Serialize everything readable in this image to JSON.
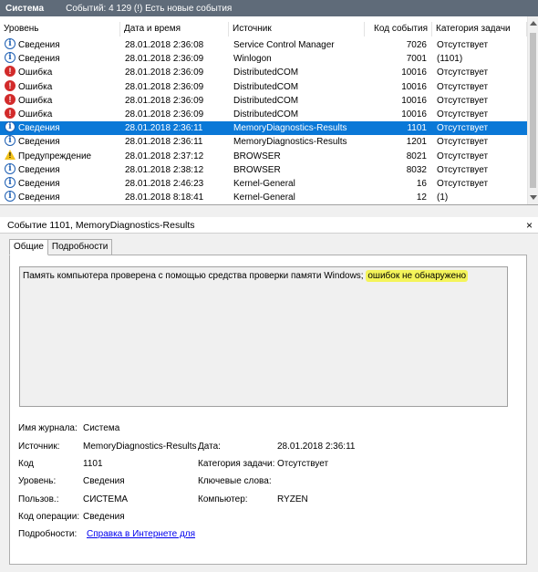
{
  "titlebar": {
    "log_name": "Система",
    "summary": "Событий: 4 129 (!) Есть новые события"
  },
  "columns": [
    "Уровень",
    "Дата и время",
    "Источник",
    "Код события",
    "Категория задачи"
  ],
  "rows": [
    {
      "icon": "info-icon",
      "level": "Сведения",
      "date": "28.01.2018 2:36:08",
      "source": "Service Control Manager",
      "id": "7026",
      "category": "Отсутствует"
    },
    {
      "icon": "info-icon",
      "level": "Сведения",
      "date": "28.01.2018 2:36:09",
      "source": "Winlogon",
      "id": "7001",
      "category": "(1101)"
    },
    {
      "icon": "error-icon",
      "level": "Ошибка",
      "date": "28.01.2018 2:36:09",
      "source": "DistributedCOM",
      "id": "10016",
      "category": "Отсутствует"
    },
    {
      "icon": "error-icon",
      "level": "Ошибка",
      "date": "28.01.2018 2:36:09",
      "source": "DistributedCOM",
      "id": "10016",
      "category": "Отсутствует"
    },
    {
      "icon": "error-icon",
      "level": "Ошибка",
      "date": "28.01.2018 2:36:09",
      "source": "DistributedCOM",
      "id": "10016",
      "category": "Отсутствует"
    },
    {
      "icon": "error-icon",
      "level": "Ошибка",
      "date": "28.01.2018 2:36:09",
      "source": "DistributedCOM",
      "id": "10016",
      "category": "Отсутствует"
    },
    {
      "icon": "info-icon",
      "level": "Сведения",
      "date": "28.01.2018 2:36:11",
      "source": "MemoryDiagnostics-Results",
      "id": "1101",
      "category": "Отсутствует",
      "selected": true
    },
    {
      "icon": "info-icon",
      "level": "Сведения",
      "date": "28.01.2018 2:36:11",
      "source": "MemoryDiagnostics-Results",
      "id": "1201",
      "category": "Отсутствует"
    },
    {
      "icon": "warning-icon",
      "level": "Предупреждение",
      "date": "28.01.2018 2:37:12",
      "source": "BROWSER",
      "id": "8021",
      "category": "Отсутствует"
    },
    {
      "icon": "info-icon",
      "level": "Сведения",
      "date": "28.01.2018 2:38:12",
      "source": "BROWSER",
      "id": "8032",
      "category": "Отсутствует"
    },
    {
      "icon": "info-icon",
      "level": "Сведения",
      "date": "28.01.2018 2:46:23",
      "source": "Kernel-General",
      "id": "16",
      "category": "Отсутствует"
    },
    {
      "icon": "info-icon",
      "level": "Сведения",
      "date": "28.01.2018 8:18:41",
      "source": "Kernel-General",
      "id": "12",
      "category": "(1)"
    }
  ],
  "detail": {
    "title": "Событие 1101, MemoryDiagnostics-Results",
    "close": "×",
    "tabs": [
      "Общие",
      "Подробности"
    ],
    "message_plain": "Память компьютера проверена с помощью средства проверки памяти Windows; ",
    "message_highlight": "ошибок не обнаружено",
    "props": {
      "log_label": "Имя журнала:",
      "log_value": "Система",
      "source_label": "Источник:",
      "source_value": "MemoryDiagnostics-Results",
      "date_label": "Дата:",
      "date_value": "28.01.2018 2:36:11",
      "id_label": "Код",
      "id_value": "1101",
      "category_label": "Категория задачи:",
      "category_value": "Отсутствует",
      "level_label": "Уровень:",
      "level_value": "Сведения",
      "keywords_label": "Ключевые слова:",
      "keywords_value": "",
      "user_label": "Пользов.:",
      "user_value": "СИСТЕМА",
      "computer_label": "Компьютер:",
      "computer_value": "RYZEN",
      "opcode_label": "Код операции:",
      "opcode_value": "Сведения",
      "more_label": "Подробности:",
      "more_link": "Справка в Интернете для"
    }
  },
  "colors": {
    "titlebar": "#5f6b79",
    "selection": "#0a78d7",
    "highlight": "#f4f45a"
  }
}
